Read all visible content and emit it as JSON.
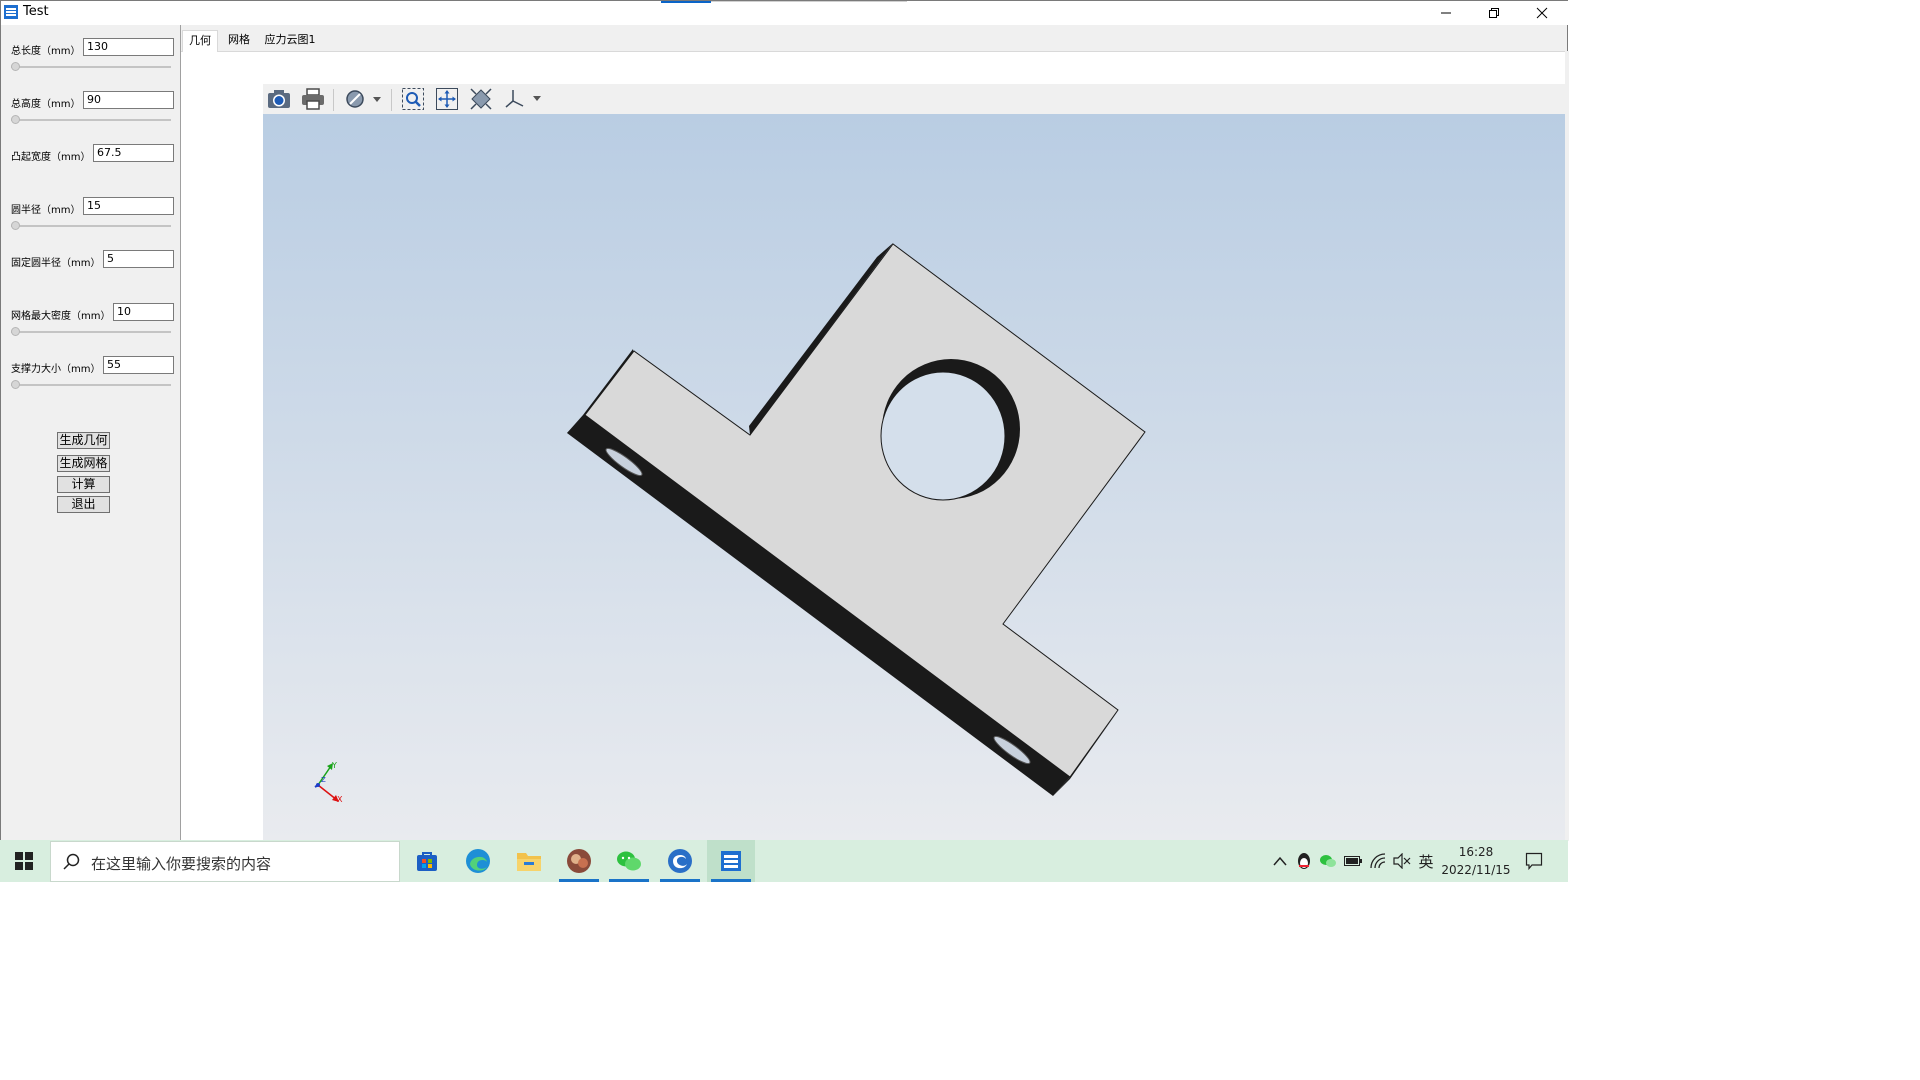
{
  "window": {
    "title": "Test"
  },
  "sidebar": {
    "fields": [
      {
        "label": "总长度（mm）",
        "value": "130",
        "slider_value": 0
      },
      {
        "label": "总高度（mm）",
        "value": "90",
        "slider_value": 0
      },
      {
        "label": "凸起宽度（mm）",
        "value": "67.5"
      },
      {
        "label": "圆半径（mm）",
        "value": "15",
        "slider_value": 0
      },
      {
        "label": "固定圆半径（mm）",
        "value": "5"
      },
      {
        "label": "网格最大密度（mm）",
        "value": "10",
        "slider_value": 0
      },
      {
        "label": "支撑力大小（mm）",
        "value": "55",
        "slider_value": 0
      }
    ],
    "buttons": {
      "generate_geometry": "生成几何",
      "generate_mesh": "生成网格",
      "compute": "计算",
      "exit": "退出"
    }
  },
  "tabs": [
    {
      "label": "几何",
      "active": true
    },
    {
      "label": "网格",
      "active": false
    },
    {
      "label": "应力云图1",
      "active": false
    }
  ],
  "toolbar": {
    "icons": [
      "camera-icon",
      "print-icon",
      "render-mode-icon",
      "zoom-window-icon",
      "pan-icon",
      "fit-all-icon",
      "axis-view-icon"
    ]
  },
  "viewport": {
    "background_top": "#b9cde3",
    "background_bottom": "#e9ebef",
    "part_face_color": "#d9d9d9",
    "axis_labels": {
      "x": "X",
      "y": "Y",
      "z": "Z"
    }
  },
  "taskbar": {
    "search_placeholder": "在这里输入你要搜索的内容",
    "tray_ime": "英",
    "clock_time": "16:28",
    "clock_date": "2022/11/15"
  }
}
